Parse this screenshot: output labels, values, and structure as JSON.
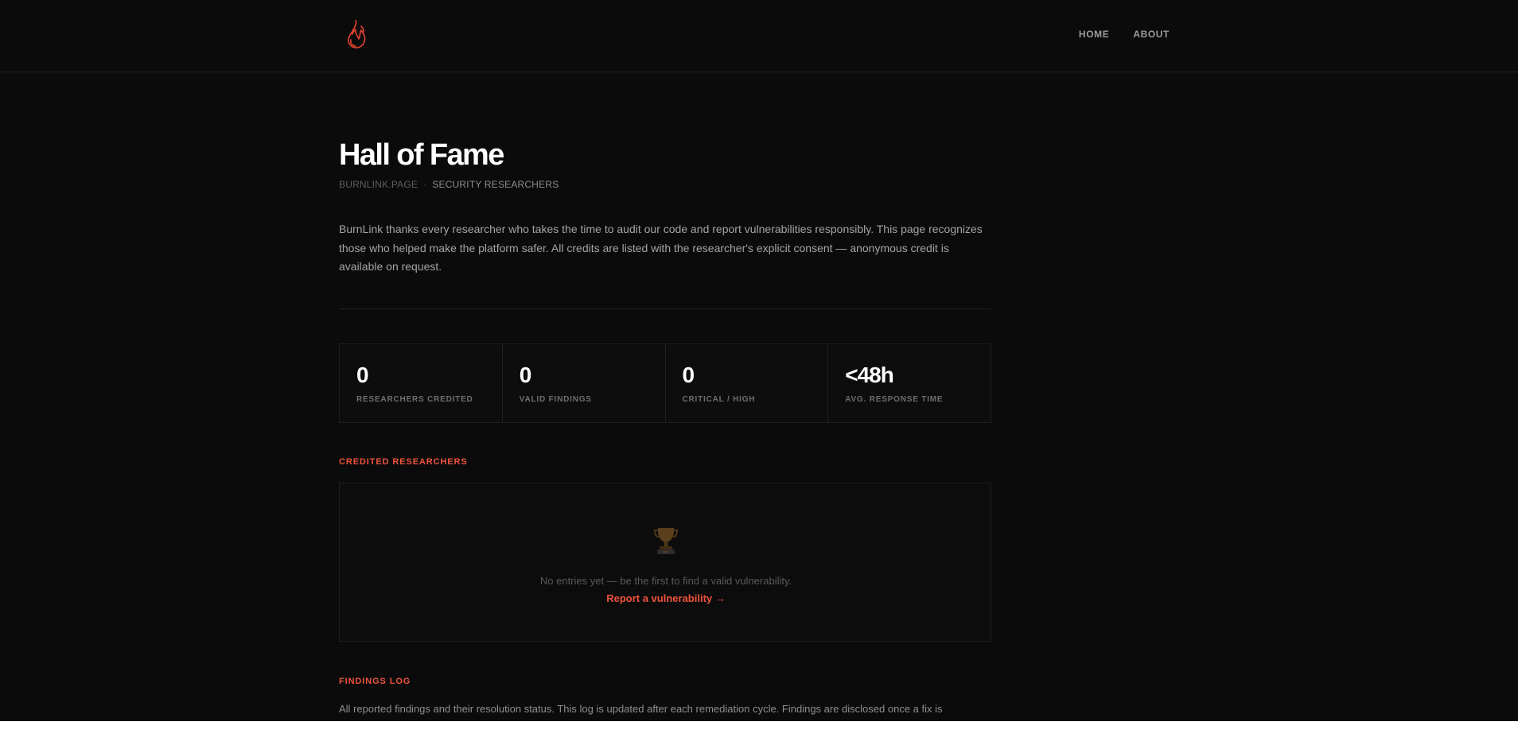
{
  "nav": {
    "home_label": "HOME",
    "about_label": "ABOUT"
  },
  "page": {
    "title": "Hall of Fame",
    "breadcrumb": {
      "site": "BURNLINK.PAGE",
      "separator": "·",
      "current": "SECURITY RESEARCHERS"
    },
    "intro": "BurnLink thanks every researcher who takes the time to audit our code and report vulnerabilities responsibly. This page recognizes those who helped make the platform safer. All credits are listed with the researcher's explicit consent — anonymous credit is available on request."
  },
  "stats": [
    {
      "value": "0",
      "label": "RESEARCHERS CREDITED"
    },
    {
      "value": "0",
      "label": "VALID FINDINGS"
    },
    {
      "value": "0",
      "label": "CRITICAL / HIGH"
    },
    {
      "value": "<48h",
      "label": "AVG. RESPONSE TIME"
    }
  ],
  "credited": {
    "heading": "CREDITED RESEARCHERS",
    "icon": "trophy-icon",
    "empty_text": "No entries yet — be the first to find a valid vulnerability.",
    "report_link": "Report a vulnerability →"
  },
  "findings": {
    "heading": "FINDINGS LOG",
    "description": "All reported findings and their resolution status. This log is updated after each remediation cycle. Findings are disclosed once a fix is"
  },
  "colors": {
    "background": "#0b0b0c",
    "accent": "#f0533b",
    "text_primary": "#ffffff",
    "text_muted": "#a4a4a9",
    "border": "#1f1f22"
  }
}
